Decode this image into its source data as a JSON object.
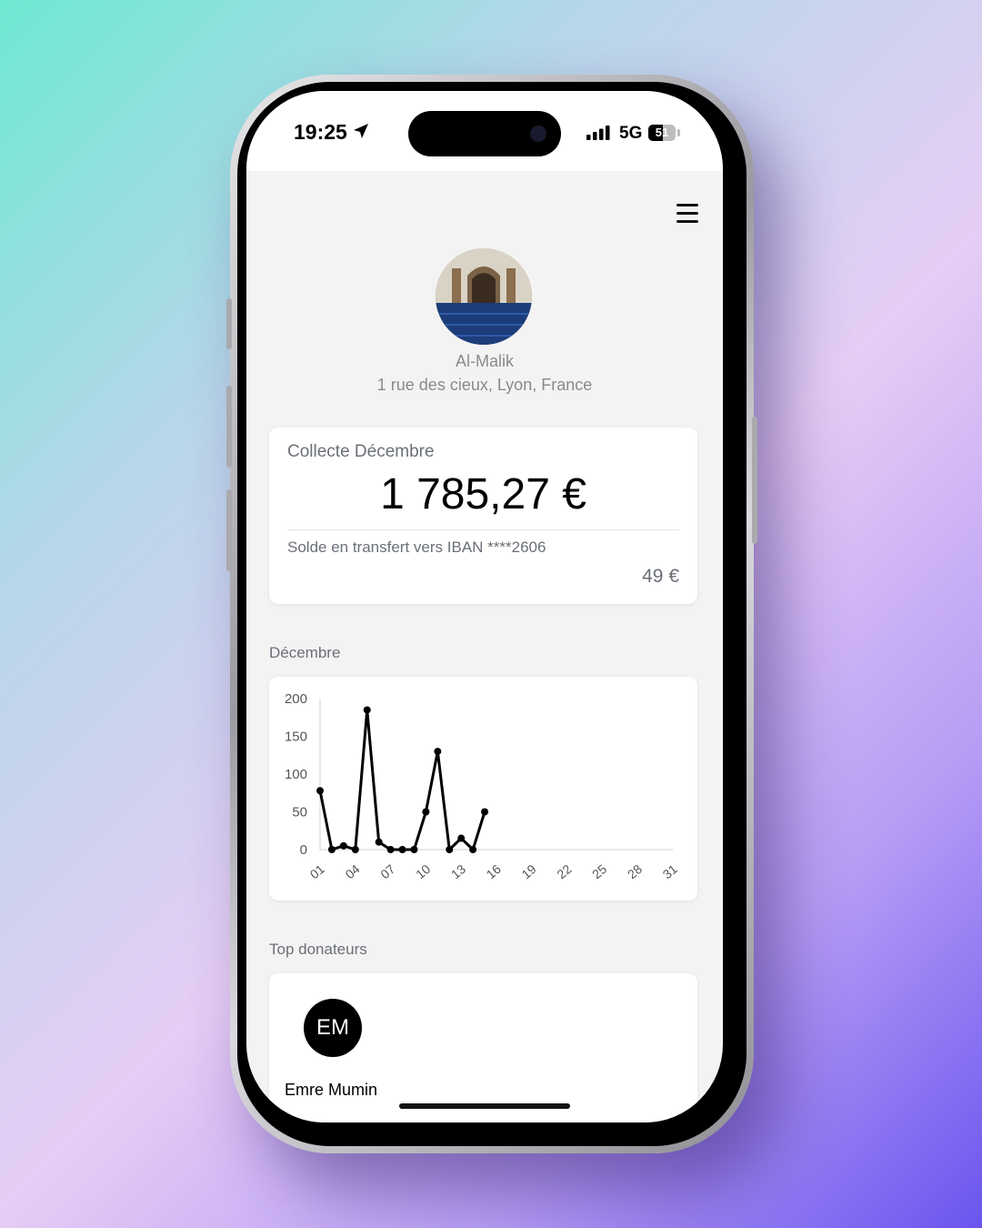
{
  "status_bar": {
    "time": "19:25",
    "network": "5G",
    "battery": "51"
  },
  "header": {
    "org_name": "Al-Malik",
    "org_address": "1 rue des cieux, Lyon, France"
  },
  "collect_card": {
    "title": "Collecte Décembre",
    "amount": "1 785,27 €",
    "transfer_label": "Solde en transfert vers IBAN ****2606",
    "transfer_amount": "49 €"
  },
  "chart_section": {
    "label": "Décembre"
  },
  "chart_data": {
    "type": "line",
    "title": "",
    "xlabel": "",
    "ylabel": "",
    "x_ticks": [
      "01",
      "04",
      "07",
      "10",
      "13",
      "16",
      "19",
      "22",
      "25",
      "28",
      "31"
    ],
    "y_ticks": [
      "0",
      "50",
      "100",
      "150",
      "200"
    ],
    "ylim": [
      0,
      200
    ],
    "xlim": [
      1,
      31
    ],
    "grid": false,
    "series": [
      {
        "x": [
          1,
          2,
          3,
          4,
          5,
          6,
          7,
          8,
          9,
          10,
          11,
          12,
          13,
          14,
          15,
          16
        ],
        "values": [
          78,
          0,
          5,
          0,
          185,
          10,
          0,
          0,
          0,
          50,
          130,
          0,
          15,
          0,
          50,
          null
        ]
      }
    ],
    "line_color": "#000000"
  },
  "donors_section": {
    "label": "Top donateurs",
    "donors": [
      {
        "initials": "EM",
        "name": "Emre Mumin"
      }
    ]
  }
}
